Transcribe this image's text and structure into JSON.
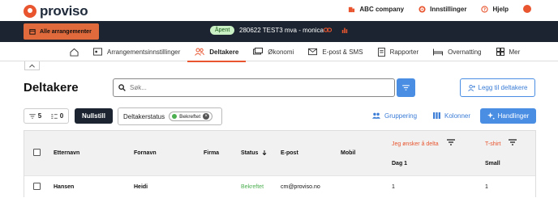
{
  "brand": {
    "name": "proviso"
  },
  "top_menu": {
    "company": "ABC company",
    "settings": "Innstillinger",
    "help": "Hjelp"
  },
  "event_bar": {
    "all_events": "Alle arrangementer",
    "status": "Åpent",
    "event_title": "280622 TEST3 mva - monica"
  },
  "nav": {
    "items": [
      {
        "label": "",
        "icon": "home-icon"
      },
      {
        "label": "Arrangementsinnstillinger",
        "icon": "settings-sliders-icon"
      },
      {
        "label": "Deltakere",
        "icon": "users-icon",
        "active": true
      },
      {
        "label": "Økonomi",
        "icon": "money-icon"
      },
      {
        "label": "E-post & SMS",
        "icon": "mail-icon"
      },
      {
        "label": "Rapporter",
        "icon": "report-icon"
      },
      {
        "label": "Overnatting",
        "icon": "bed-icon"
      },
      {
        "label": "Mer",
        "icon": "grid-icon"
      }
    ]
  },
  "page": {
    "title": "Deltakere",
    "search_placeholder": "Søk...",
    "add_button": "Legg til deltakere"
  },
  "toolbar": {
    "filter_count": "5",
    "sort_count": "0",
    "reset": "Nullstill",
    "filter_label": "Deltakerstatus",
    "filter_chip": "Bekreftet",
    "grouping": "Gruppering",
    "columns": "Kolonner",
    "actions": "Handlinger"
  },
  "table": {
    "headers": {
      "last_name": "Etternavn",
      "first_name": "Fornavn",
      "company": "Firma",
      "status": "Status",
      "email": "E-post",
      "mobile": "Mobil",
      "wish": "Jeg ønsker å delta",
      "wish_sub": "Dag 1",
      "tshirt": "T-shirt",
      "tshirt_sub": "Small"
    },
    "rows": [
      {
        "last_name": "Hansen",
        "first_name": "Heidi",
        "company": "",
        "status": "Bekreftet",
        "email": "cm@proviso.no",
        "mobile": "",
        "wish": "1",
        "tshirt": "1"
      }
    ]
  },
  "colors": {
    "accent": "#e8552f",
    "dark": "#1b2430",
    "primary_blue": "#4a8ee4",
    "status_green": "#4caf50"
  }
}
